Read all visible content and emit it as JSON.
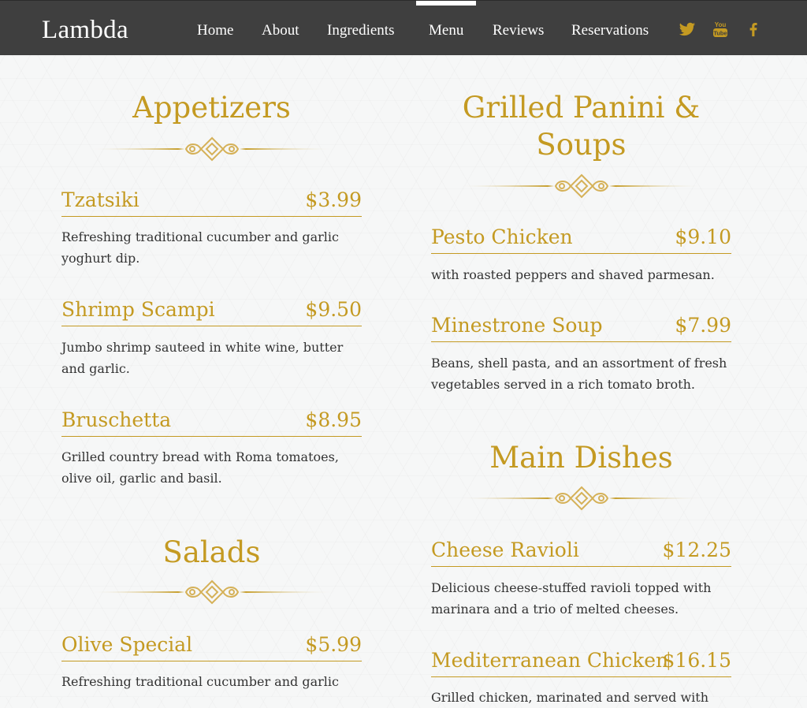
{
  "brand": "Lambda",
  "nav": [
    "Home",
    "About",
    "Ingredients",
    "Menu",
    "Reviews",
    "Reservations"
  ],
  "active_nav": "Menu",
  "social": [
    "twitter-icon",
    "youtube-icon",
    "facebook-icon"
  ],
  "colors": {
    "accent": "#c49a22",
    "navbar": "#3f3f3f",
    "text": "#333333"
  },
  "menu": {
    "appetizers": {
      "title": "Appetizers",
      "items": [
        {
          "name": "Tzatsiki",
          "price": "$3.99",
          "desc": "Refreshing traditional cucumber and garlic yoghurt dip."
        },
        {
          "name": "Shrimp Scampi",
          "price": "$9.50",
          "desc": "Jumbo shrimp sauteed in white wine, butter and garlic."
        },
        {
          "name": "Bruschetta",
          "price": "$8.95",
          "desc": "Grilled country bread with Roma tomatoes, olive oil, garlic and basil."
        }
      ]
    },
    "salads": {
      "title": "Salads",
      "items": [
        {
          "name": "Olive Special",
          "price": "$5.99",
          "desc": "Refreshing traditional cucumber and garlic"
        }
      ]
    },
    "panini": {
      "title_line1": "Grilled Panini &",
      "title_line2": "Soups",
      "items": [
        {
          "name": "Pesto Chicken",
          "price": "$9.10",
          "desc": "with roasted peppers and shaved parmesan."
        },
        {
          "name": "Minestrone Soup",
          "price": "$7.99",
          "desc": "Beans, shell pasta, and an assortment of fresh vegetables served in a rich tomato broth."
        }
      ]
    },
    "mains": {
      "title": "Main Dishes",
      "items": [
        {
          "name": "Cheese Ravioli",
          "price": "$12.25",
          "desc": "Delicious cheese-stuffed ravioli topped with marinara and a trio of melted cheeses."
        },
        {
          "name": "Mediterranean Chicken",
          "price": "$16.15",
          "desc": "Grilled chicken, marinated and served with"
        }
      ]
    }
  }
}
